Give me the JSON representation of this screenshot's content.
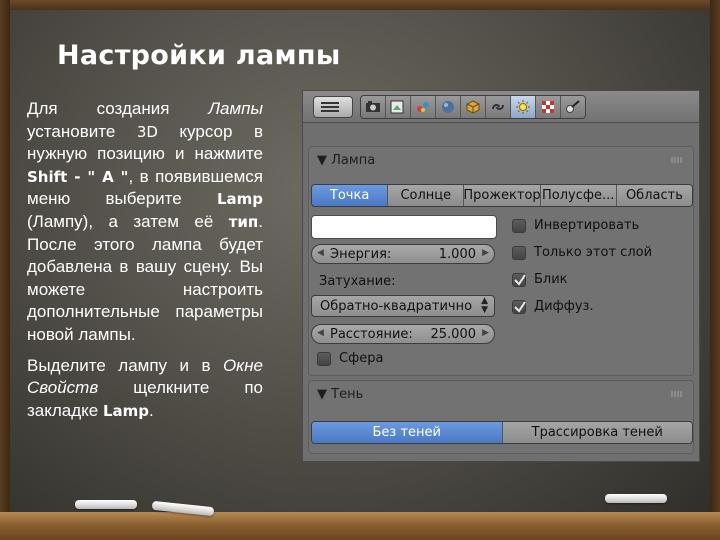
{
  "slide": {
    "title": "Настройки лампы",
    "p1": [
      "Для создания ",
      "Лампы",
      " установите ",
      "3D",
      " курсор в нужную позицию и нажмите ",
      "Shift - \" A \"",
      ", в появившемся меню выберите ",
      "Lamp",
      " (Лампу), а затем её ",
      "тип",
      ". После этого лампа будет добавлена в вашу сцену. Вы можете настроить дополнительные параметры новой лампы."
    ],
    "p2": [
      "Выделите лампу и в ",
      "Окне Свойств",
      " щелкните по закладке ",
      "Lamp",
      "."
    ]
  },
  "blender": {
    "tab_icons": [
      "render-icon",
      "scene-icon",
      "world-icon",
      "object-icon",
      "constraints-icon",
      "modifiers-icon",
      "lamp-data-icon",
      "texture-icon",
      "physics-icon"
    ],
    "active_tab": "lamp-data-icon",
    "lamp_panel": {
      "header": "Лампа",
      "types": [
        "Точка",
        "Солнце",
        "Прожектор",
        "Полусфе...",
        "Область"
      ],
      "selected_type": "Точка",
      "color": "#ffffff",
      "energy_label": "Энергия:",
      "energy_value": "1.000",
      "falloff_label": "Затухание:",
      "falloff_value": "Обратно-квадратично",
      "distance_label": "Расстояние:",
      "distance_value": "25.000",
      "sphere_label": "Сфера",
      "sphere_checked": false,
      "negative_label": "Инвертировать",
      "negative_checked": false,
      "this_layer_label": "Только этот слой",
      "this_layer_checked": false,
      "specular_label": "Блик",
      "specular_checked": true,
      "diffuse_label": "Диффуз.",
      "diffuse_checked": true
    },
    "shadow_panel": {
      "header": "Тень",
      "options": [
        "Без теней",
        "Трассировка теней"
      ],
      "selected": "Без теней"
    }
  },
  "colors": {
    "accent_blue": "#5a88d4",
    "panel_bg": "#727272",
    "board": "#55534b"
  }
}
